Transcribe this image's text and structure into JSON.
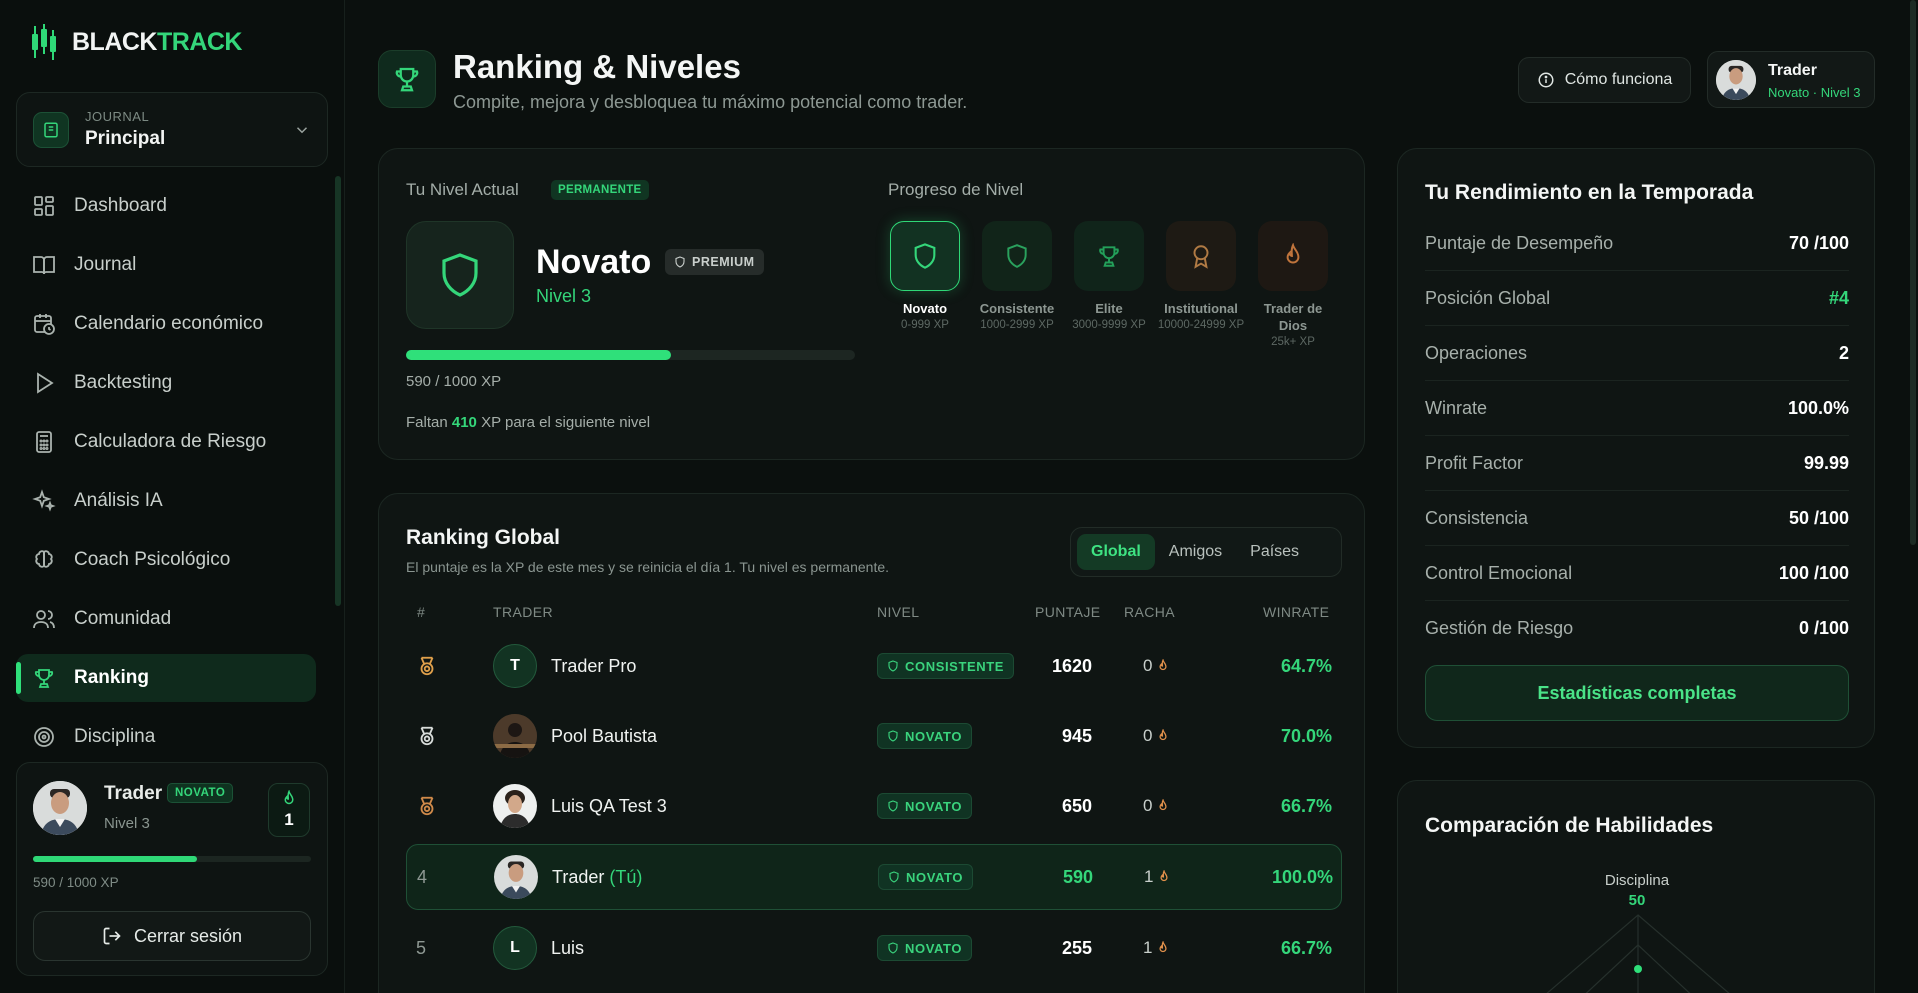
{
  "brand": {
    "part1": "BLACK",
    "part2": "TRACK"
  },
  "journal": {
    "small_label": "JOURNAL",
    "name": "Principal"
  },
  "nav": [
    {
      "label": "Dashboard",
      "icon": "grid-icon"
    },
    {
      "label": "Journal",
      "icon": "book-open-icon"
    },
    {
      "label": "Calendario económico",
      "icon": "calendar-clock-icon"
    },
    {
      "label": "Backtesting",
      "icon": "play-icon"
    },
    {
      "label": "Calculadora de Riesgo",
      "icon": "calculator-icon"
    },
    {
      "label": "Análisis IA",
      "icon": "sparkles-icon"
    },
    {
      "label": "Coach Psicológico",
      "icon": "brain-icon"
    },
    {
      "label": "Comunidad",
      "icon": "users-icon"
    },
    {
      "label": "Ranking",
      "icon": "trophy-icon",
      "active": true
    },
    {
      "label": "Disciplina",
      "icon": "target-icon"
    }
  ],
  "sidebar_user": {
    "name": "Trader",
    "badge": "NOVATO",
    "level": "Nivel 3",
    "streak": "1",
    "xp_text": "590 / 1000 XP",
    "progress": 0.59,
    "logout_label": "Cerrar sesión"
  },
  "header": {
    "title": "Ranking & Niveles",
    "subtitle": "Compite, mejora y desbloquea tu máximo potencial como trader.",
    "how_label": "Cómo funciona",
    "user_name": "Trader",
    "user_sub": "Novato · Nivel 3"
  },
  "level": {
    "section_label": "Tu Nivel Actual",
    "permanent_badge": "PERMANENTE",
    "name": "Novato",
    "premium_badge": "PREMIUM",
    "number": "Nivel 3",
    "progress": 0.59,
    "xp_text": "590 / 1000 XP",
    "missing_prefix": "Faltan",
    "missing_value": "410",
    "missing_suffix": "XP para el siguiente nivel",
    "progress_label": "Progreso de Nivel",
    "tiers": [
      {
        "name": "Novato",
        "range": "0-999 XP",
        "icon": "shield-icon"
      },
      {
        "name": "Consistente",
        "range": "1000-2999 XP",
        "icon": "shield-icon"
      },
      {
        "name": "Elite",
        "range": "3000-9999 XP",
        "icon": "trophy-icon"
      },
      {
        "name": "Institutional",
        "range": "10000-24999 XP",
        "icon": "award-icon"
      },
      {
        "name": "Trader de Dios",
        "range": "25k+ XP",
        "icon": "flame-icon"
      }
    ]
  },
  "ranking": {
    "title": "Ranking Global",
    "subtitle": "El puntaje es la XP de este mes y se reinicia el día 1. Tu nivel es permanente.",
    "tabs": [
      "Global",
      "Amigos",
      "Países"
    ],
    "columns": [
      "#",
      "TRADER",
      "NIVEL",
      "PUNTAJE",
      "RACHA",
      "WINRATE"
    ],
    "rows": [
      {
        "rank": "",
        "medal": "gold",
        "initial": "T",
        "name": "Trader Pro",
        "you": "",
        "level": "CONSISTENTE",
        "score": "1620",
        "streak": "0",
        "winrate": "64.7%"
      },
      {
        "rank": "",
        "medal": "silver",
        "initial": "",
        "name": "Pool Bautista",
        "you": "",
        "level": "NOVATO",
        "score": "945",
        "streak": "0",
        "winrate": "70.0%"
      },
      {
        "rank": "",
        "medal": "bronze",
        "initial": "",
        "name": "Luis QA Test 3",
        "you": "",
        "level": "NOVATO",
        "score": "650",
        "streak": "0",
        "winrate": "66.7%"
      },
      {
        "rank": "4",
        "medal": "",
        "initial": "",
        "name": "Trader",
        "you": "(Tú)",
        "level": "NOVATO",
        "score": "590",
        "streak": "1",
        "winrate": "100.0%"
      },
      {
        "rank": "5",
        "medal": "",
        "initial": "L",
        "name": "Luis",
        "you": "",
        "level": "NOVATO",
        "score": "255",
        "streak": "1",
        "winrate": "66.7%"
      }
    ]
  },
  "season": {
    "title": "Tu Rendimiento en la Temporada",
    "stats": [
      {
        "label": "Puntaje de Desempeño",
        "value": "70 /100"
      },
      {
        "label": "Posición Global",
        "value": "#4"
      },
      {
        "label": "Operaciones",
        "value": "2"
      },
      {
        "label": "Winrate",
        "value": "100.0%"
      },
      {
        "label": "Profit Factor",
        "value": "99.99"
      },
      {
        "label": "Consistencia",
        "value": "50 /100"
      },
      {
        "label": "Control Emocional",
        "value": "100 /100"
      },
      {
        "label": "Gestión de Riesgo",
        "value": "0 /100"
      }
    ],
    "button_label": "Estadísticas completas"
  },
  "skills": {
    "title": "Comparación de Habilidades",
    "axis_label": "Disciplina",
    "axis_value": "50"
  },
  "colors": {
    "accent": "#34d67a",
    "bg": "#0b100e",
    "card": "#0f1513"
  }
}
